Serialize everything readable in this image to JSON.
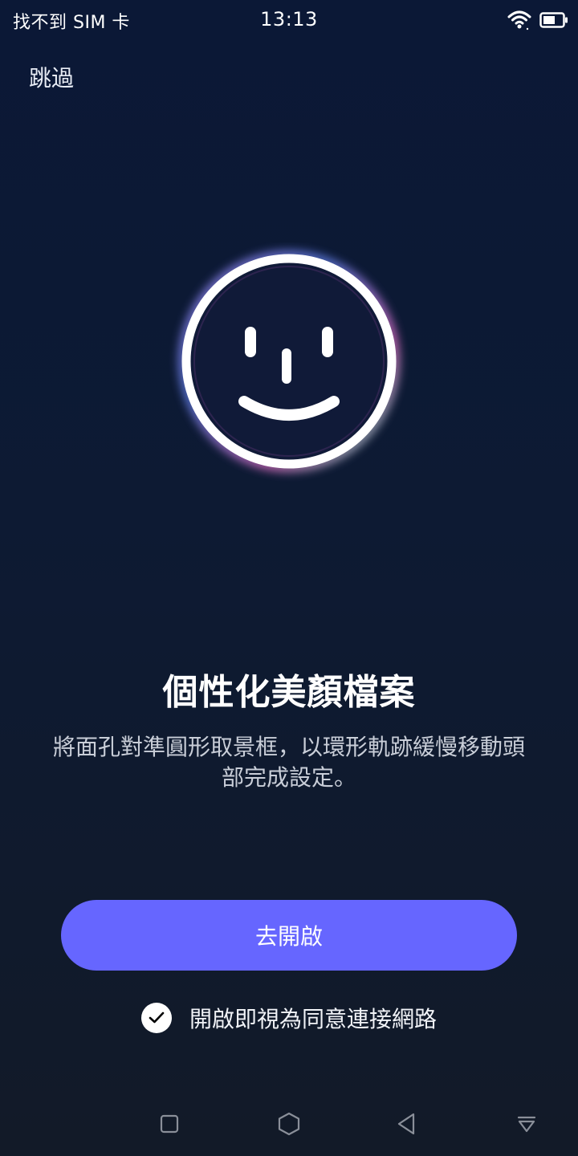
{
  "status_bar": {
    "carrier": "找不到 SIM 卡",
    "time": "13:13",
    "icons": [
      "wifi-icon",
      "battery-icon"
    ]
  },
  "header": {
    "skip_label": "跳過"
  },
  "hero": {
    "icon": "smiley-face-icon"
  },
  "content": {
    "title": "個性化美顏檔案",
    "description": "將面孔對準圓形取景框，以環形軌跡緩慢移動頭部完成設定。"
  },
  "actions": {
    "primary_label": "去開啟",
    "consent_label": "開啟即視為同意連接網路",
    "consent_checked": true
  },
  "nav_bar": {
    "icons": [
      "square-icon",
      "hexagon-icon",
      "back-triangle-icon",
      "notification-down-icon"
    ]
  },
  "colors": {
    "background": "#0d1a33",
    "accent": "#6666ff",
    "text": "#ffffff"
  }
}
